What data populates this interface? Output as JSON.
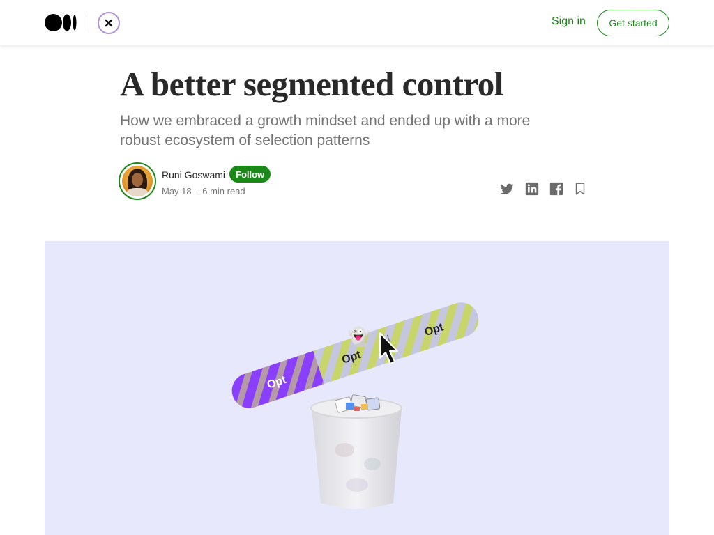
{
  "nav": {
    "logo": "medium-logo",
    "publication_logo": "close-icon",
    "sign_in": "Sign in",
    "get_started": "Get started",
    "accent": "#1a8917"
  },
  "article": {
    "title": "A better segmented control",
    "subtitle": "How we embraced a growth mindset and ended up with a more robust ecosystem of selection patterns",
    "author": {
      "name": "Runi Goswami",
      "follow": "Follow",
      "date": "May 18",
      "separator": "·",
      "read_time": "6 min read"
    },
    "share": {
      "icons": [
        "twitter-icon",
        "linkedin-icon",
        "facebook-icon",
        "bookmark-icon"
      ]
    }
  },
  "hero": {
    "background": "#e8e8fd",
    "segments": [
      {
        "label": "Opt",
        "color": "#8a3ffc"
      },
      {
        "label": "Opt",
        "color": "#c6d66a"
      },
      {
        "label": "Opt",
        "color": "#c6d66a"
      }
    ],
    "emoji": "👻"
  }
}
